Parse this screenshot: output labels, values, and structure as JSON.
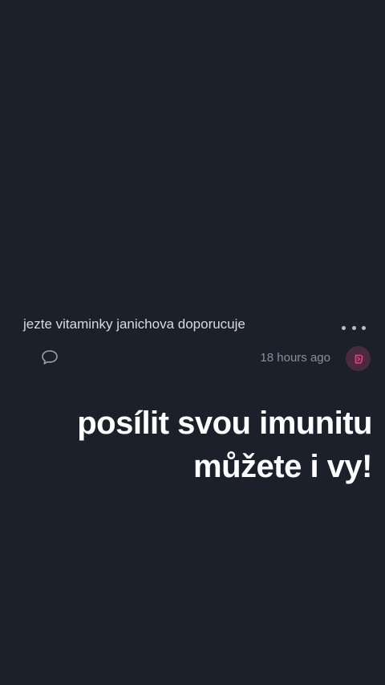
{
  "post": {
    "text": "jezte vitaminky janichova doporucuje",
    "timestamp": "18 hours ago"
  },
  "icons": {
    "more": "more-dots-icon",
    "comment": "comment-bubble-icon",
    "reaction": "reaction-badge-icon"
  },
  "caption": {
    "line1": "posílit svou imunitu",
    "line2": "můžete i vy!"
  },
  "colors": {
    "background": "#1b202b",
    "accent": "#e83e8c"
  }
}
